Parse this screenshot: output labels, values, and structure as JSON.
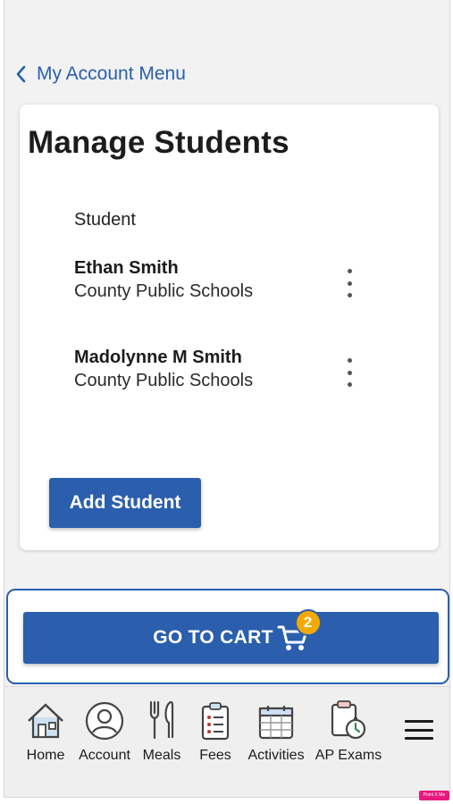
{
  "nav": {
    "back_label": "My Account Menu"
  },
  "card": {
    "title": "Manage Students",
    "column_header": "Student",
    "students": [
      {
        "name": "Ethan Smith",
        "school": "County Public Schools"
      },
      {
        "name": "Madolynne M Smith",
        "school": "County Public Schools"
      }
    ],
    "add_button": "Add Student"
  },
  "cart": {
    "label": "GO TO CART",
    "count": "2"
  },
  "bottom_nav": {
    "items": [
      {
        "label": "Home",
        "icon": "home-icon"
      },
      {
        "label": "Account",
        "icon": "account-icon"
      },
      {
        "label": "Meals",
        "icon": "meals-icon"
      },
      {
        "label": "Fees",
        "icon": "fees-icon"
      },
      {
        "label": "Activities",
        "icon": "calendar-icon"
      },
      {
        "label": "AP Exams",
        "icon": "exam-clipboard-icon"
      }
    ],
    "menu_icon": "hamburger-menu-icon"
  },
  "overlay_tag": "Point X Me",
  "colors": {
    "primary": "#2b5fad",
    "badge": "#f2a900",
    "background": "#f2f2f2"
  }
}
